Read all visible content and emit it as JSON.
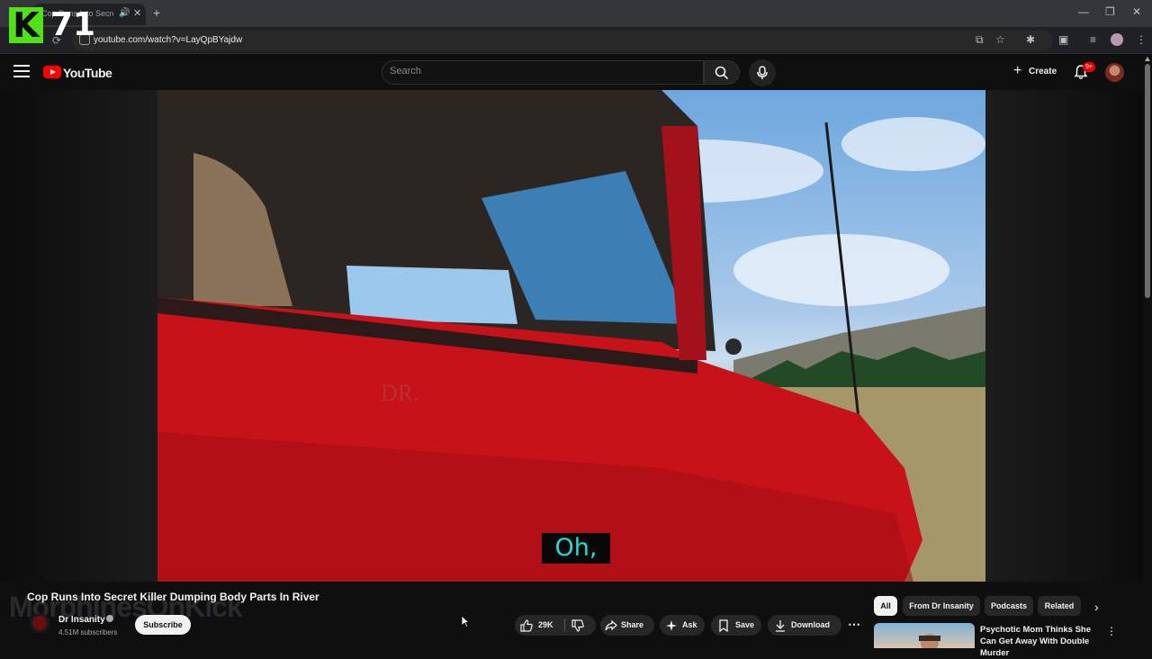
{
  "overlay": {
    "logo_letter": "K",
    "logo_number": "71"
  },
  "browser": {
    "tab_title": "Cop Runs Into Secret K",
    "url": "youtube.com/watch?v=LayQpBYajdw"
  },
  "youtube": {
    "wordmark": "YouTube",
    "search_placeholder": "Search",
    "create_label": "Create",
    "notification_badge": "9+"
  },
  "video": {
    "caption": "Oh,",
    "title": "Cop Runs Into Secret Killer Dumping Body Parts In River",
    "watermark": "MorphinesOnKick"
  },
  "channel": {
    "name": "Dr Insanity",
    "subscribers": "4.51M subscribers",
    "subscribe_label": "Subscribe"
  },
  "actions": {
    "likes": "29K",
    "share": "Share",
    "ask": "Ask",
    "save": "Save",
    "download": "Download"
  },
  "chips": [
    "All",
    "From Dr Insanity",
    "Podcasts",
    "Related"
  ],
  "recommendation": {
    "title": "Psychotic Mom Thinks She Can Get Away With Double Murder"
  },
  "colors": {
    "youtube_red": "#ff0000",
    "logo_green": "#52e01a",
    "caption_cyan": "#2ed6d6",
    "truck_red": "#d0121a"
  }
}
